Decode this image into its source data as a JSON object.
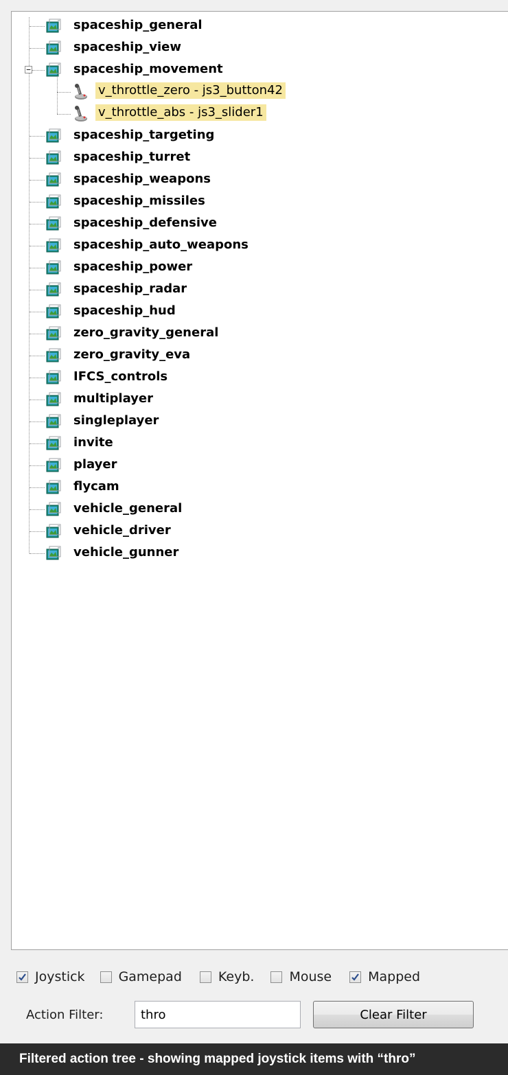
{
  "tree": {
    "nodes": [
      {
        "label": "spaceship_general"
      },
      {
        "label": "spaceship_view"
      },
      {
        "label": "spaceship_movement",
        "expanded": true,
        "expander": "−",
        "children": [
          {
            "label": "v_throttle_zero - js3_button42"
          },
          {
            "label": "v_throttle_abs - js3_slider1"
          }
        ]
      },
      {
        "label": "spaceship_targeting"
      },
      {
        "label": "spaceship_turret"
      },
      {
        "label": "spaceship_weapons"
      },
      {
        "label": "spaceship_missiles"
      },
      {
        "label": "spaceship_defensive"
      },
      {
        "label": "spaceship_auto_weapons"
      },
      {
        "label": "spaceship_power"
      },
      {
        "label": "spaceship_radar"
      },
      {
        "label": "spaceship_hud"
      },
      {
        "label": "zero_gravity_general"
      },
      {
        "label": "zero_gravity_eva"
      },
      {
        "label": "IFCS_controls"
      },
      {
        "label": "multiplayer"
      },
      {
        "label": "singleplayer"
      },
      {
        "label": "invite"
      },
      {
        "label": "player"
      },
      {
        "label": "flycam"
      },
      {
        "label": "vehicle_general"
      },
      {
        "label": "vehicle_driver"
      },
      {
        "label": "vehicle_gunner"
      }
    ],
    "node_icon": "action-map-icon",
    "child_icon": "joystick-icon",
    "highlight_color": "#f6e7a0"
  },
  "filters": {
    "checkboxes": [
      {
        "label": "Joystick",
        "checked": true
      },
      {
        "label": "Gamepad",
        "checked": false
      },
      {
        "label": "Keyb.",
        "checked": false
      },
      {
        "label": "Mouse",
        "checked": false
      },
      {
        "label": "Mapped",
        "checked": true
      }
    ]
  },
  "action_filter": {
    "label": "Action Filter:",
    "value": "thro",
    "clear_button_label": "Clear Filter"
  },
  "caption": "Filtered action tree - showing mapped joystick items with “thro”"
}
